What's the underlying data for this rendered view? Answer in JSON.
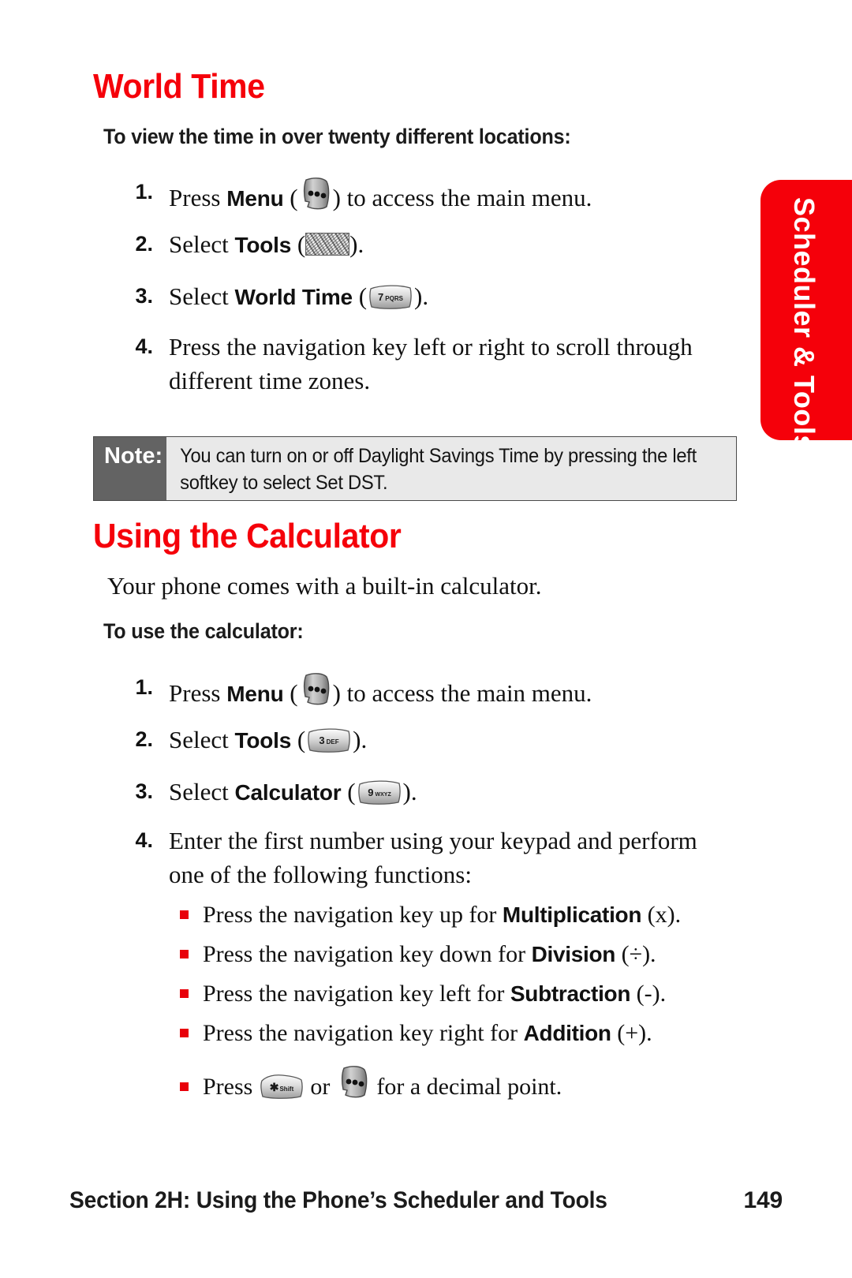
{
  "side_tab": {
    "label": "Scheduler & Tools",
    "color": "#F5000A",
    "text_color": "#FFFFFF"
  },
  "headings": {
    "world_time": "World Time",
    "using_calculator": "Using the Calculator",
    "accent_color": "#F5000A"
  },
  "world_time": {
    "intro": "To view the time in over twenty different locations:",
    "steps": [
      {
        "num": "1.",
        "pre": "Press ",
        "bold": "Menu",
        "icon": "menu-key-icon",
        "post": " to access the main menu."
      },
      {
        "num": "2.",
        "pre": "Select ",
        "bold": "Tools",
        "icon": "noise-key-icon",
        "post": "."
      },
      {
        "num": "3.",
        "pre": "Select ",
        "bold": "World Time",
        "icon": "key-7-pqrs-icon",
        "icon_label": "7 PQRS",
        "post": "."
      },
      {
        "num": "4.",
        "pre": "Press the navigation key left or right to scroll through different time zones.",
        "bold": "",
        "icon": "",
        "post": ""
      }
    ]
  },
  "note": {
    "label": "Note:",
    "text": "You can turn on or off Daylight Savings Time by pressing the left softkey to select Set DST.",
    "label_bg": "#636363",
    "body_bg": "#E9E9E9"
  },
  "calculator": {
    "paragraph": "Your phone comes with a built-in calculator.",
    "intro": "To use the calculator:",
    "steps": [
      {
        "num": "1.",
        "pre": "Press ",
        "bold": "Menu",
        "icon": "menu-key-icon",
        "post": " to access the main menu."
      },
      {
        "num": "2.",
        "pre": "Select ",
        "bold": "Tools",
        "icon": "key-3-def-icon",
        "icon_label": "3 DEF",
        "post": "."
      },
      {
        "num": "3.",
        "pre": "Select ",
        "bold": "Calculator",
        "icon": "key-9-wxyz-icon",
        "icon_label": "9 WXYZ",
        "post": "."
      },
      {
        "num": "4.",
        "pre": "Enter the first number using your keypad and perform one of the following functions:",
        "bold": "",
        "icon": "",
        "post": ""
      }
    ],
    "bullets": [
      {
        "pre": "Press the navigation key up for ",
        "bold": "Multiplication",
        "post": " (x)."
      },
      {
        "pre": "Press the navigation key down for ",
        "bold": "Division",
        "post": " (÷)."
      },
      {
        "pre": "Press the navigation key left for ",
        "bold": "Subtraction",
        "post": " (-)."
      },
      {
        "pre": "Press the navigation key right for ",
        "bold": "Addition",
        "post": " (+)."
      }
    ],
    "decimal_bullet": {
      "pre": "Press ",
      "mid": " or ",
      "post": " for a decimal point.",
      "star_key_label": "✳ Shift"
    },
    "bullet_color": "#E8000A"
  },
  "footer": {
    "title": "Section 2H: Using the Phone’s Scheduler and Tools",
    "page_number": "149"
  }
}
